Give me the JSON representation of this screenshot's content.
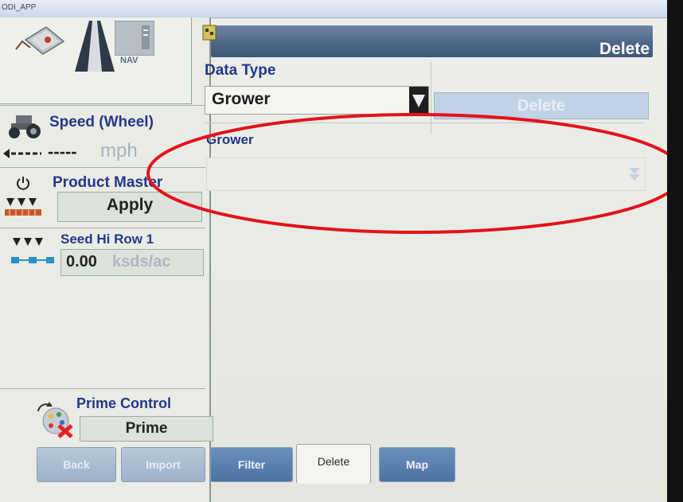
{
  "app": {
    "title": "ODI_APP"
  },
  "left_panel": {
    "icons": [
      "planter-icon",
      "field-road-icon",
      "nav-display-icon"
    ],
    "nav_label": "NAV",
    "speed": {
      "title": "Speed (Wheel)",
      "value": "-----",
      "unit": "mph"
    },
    "product_master": {
      "title": "Product Master",
      "button_label": "Apply"
    },
    "seed": {
      "title": "Seed Hi Row 1",
      "value": "0.00",
      "unit": "ksds/ac"
    },
    "prime": {
      "title": "Prime Control",
      "button_label": "Prime"
    }
  },
  "header": {
    "title": "Delete"
  },
  "data_type": {
    "label": "Data Type",
    "selected": "Grower",
    "delete_label": "Delete"
  },
  "grower": {
    "label": "Grower",
    "selected": ""
  },
  "tabs": [
    {
      "label": "Back",
      "style": "grey"
    },
    {
      "label": "Import",
      "style": "grey"
    },
    {
      "label": "Filter",
      "style": "grey"
    },
    {
      "label": "Delete",
      "style": "active"
    },
    {
      "label": "Map",
      "style": "blue"
    }
  ],
  "colors": {
    "accent": "#24388a",
    "header": "#4d6688",
    "annotation": "#e3121b"
  }
}
